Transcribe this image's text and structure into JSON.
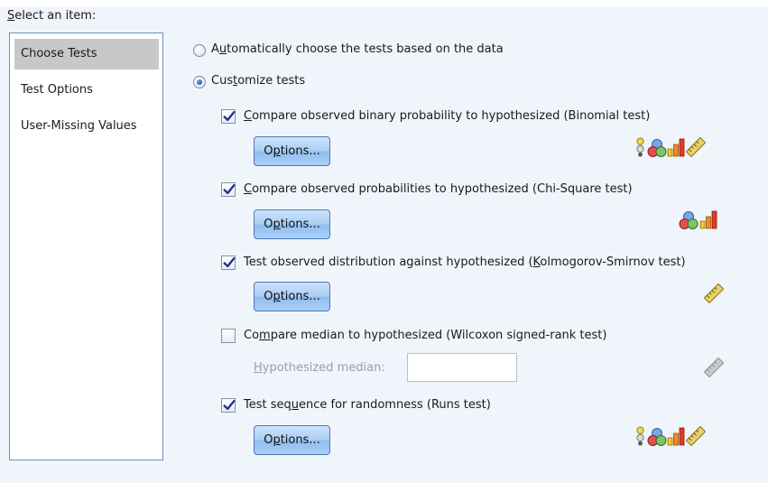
{
  "header": {
    "select_label": "Select an item:"
  },
  "sidebar": {
    "items": [
      {
        "label": "Choose Tests",
        "selected": true
      },
      {
        "label": "Test Options",
        "selected": false
      },
      {
        "label": "User-Missing Values",
        "selected": false
      }
    ]
  },
  "mode": {
    "auto_label": "Automatically choose the tests based on the data",
    "custom_label": "Customize tests",
    "selected": "custom"
  },
  "tests": {
    "binomial": {
      "label": "Compare observed binary probability to hypothesized (Binomial test)",
      "checked": true,
      "options_label": "Options...",
      "icons": [
        "nominal-icon",
        "ordinal-icon",
        "bar-chart-icon",
        "ruler-icon"
      ]
    },
    "chisq": {
      "label": "Compare observed probabilities to hypothesized (Chi-Square test)",
      "checked": true,
      "options_label": "Options...",
      "icons": [
        "ordinal-icon",
        "bar-chart-icon"
      ]
    },
    "ks": {
      "label": "Test observed distribution against hypothesized (Kolmogorov-Smirnov test)",
      "checked": true,
      "options_label": "Options...",
      "icons": [
        "ruler-icon"
      ]
    },
    "wilcoxon": {
      "label": "Compare median to hypothesized (Wilcoxon signed-rank test)",
      "checked": false,
      "median_label": "Hypothesized median:",
      "median_value": "",
      "icons": [
        "ruler-icon-disabled"
      ]
    },
    "runs": {
      "label": "Test sequence for randomness (Runs test)",
      "checked": true,
      "options_label": "Options...",
      "icons": [
        "nominal-icon",
        "ordinal-icon",
        "bar-chart-icon",
        "ruler-icon"
      ]
    }
  },
  "colors": {
    "background": "#f0f5fb",
    "button": "#a9cdf4",
    "check": "#1b2d8a",
    "list_selected": "#c8c8c8"
  }
}
